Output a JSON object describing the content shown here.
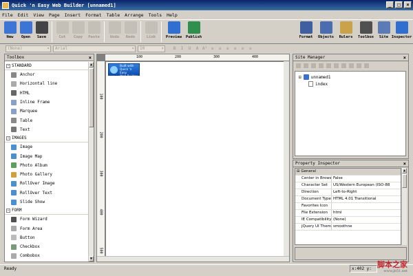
{
  "window": {
    "title": "Quick 'n Easy Web Builder [unnamed1]",
    "min": "_",
    "max": "□",
    "close": "×"
  },
  "menu": [
    "File",
    "Edit",
    "View",
    "Page",
    "Insert",
    "Format",
    "Table",
    "Arrange",
    "Tools",
    "Help"
  ],
  "toolbar": {
    "left": [
      {
        "label": "New",
        "icon": "new-icon",
        "color": "#3b76d6",
        "enabled": true
      },
      {
        "label": "Open",
        "icon": "open-icon",
        "color": "#3b76d6",
        "enabled": true
      },
      {
        "label": "Save",
        "icon": "save-icon",
        "color": "#444444",
        "enabled": true
      },
      {
        "label": "Cut",
        "icon": "cut-icon",
        "color": "#999999",
        "enabled": false
      },
      {
        "label": "Copy",
        "icon": "copy-icon",
        "color": "#999999",
        "enabled": false
      },
      {
        "label": "Paste",
        "icon": "paste-icon",
        "color": "#999999",
        "enabled": false
      },
      {
        "label": "Undo",
        "icon": "undo-icon",
        "color": "#999999",
        "enabled": false
      },
      {
        "label": "Redo",
        "icon": "redo-icon",
        "color": "#999999",
        "enabled": false
      },
      {
        "label": "Link",
        "icon": "link-icon",
        "color": "#999999",
        "enabled": false
      },
      {
        "label": "Preview",
        "icon": "preview-icon",
        "color": "#2f6fcf",
        "enabled": true
      },
      {
        "label": "Publish",
        "icon": "publish-icon",
        "color": "#2f8f4f",
        "enabled": true
      }
    ],
    "right": [
      {
        "label": "Format",
        "icon": "format-icon",
        "color": "#3f5fa0"
      },
      {
        "label": "Objects",
        "icon": "objects-icon",
        "color": "#4a6cb0"
      },
      {
        "label": "Rulers",
        "icon": "rulers-icon",
        "color": "#c9a24a"
      },
      {
        "label": "Toolbox",
        "icon": "toolbox-icon",
        "color": "#505050"
      },
      {
        "label": "Site",
        "icon": "site-icon",
        "color": "#5a7ab8"
      },
      {
        "label": "Inspector",
        "icon": "inspector-icon",
        "color": "#2f6fcf"
      }
    ]
  },
  "format_bar": {
    "style": "(None)",
    "font": "Arial",
    "size": "10",
    "buttons": [
      "B",
      "I",
      "U",
      "A",
      "A²",
      "≡",
      "≡",
      "≡",
      "≡",
      "≡",
      "≡"
    ]
  },
  "toolbox": {
    "title": "Toolbox",
    "groups": [
      {
        "name": "STANDARD",
        "items": [
          {
            "label": "Anchor",
            "icon": "anchor-icon",
            "color": "#888888"
          },
          {
            "label": "Horizontal line",
            "icon": "horizontal-line-icon",
            "color": "#aaaaaa"
          },
          {
            "label": "HTML",
            "icon": "html-icon",
            "color": "#666666"
          },
          {
            "label": "Inline Frame",
            "icon": "inline-frame-icon",
            "color": "#8aa0c8"
          },
          {
            "label": "Marquee",
            "icon": "marquee-icon",
            "color": "#8aa0c8"
          },
          {
            "label": "Table",
            "icon": "table-icon",
            "color": "#8a8a8a"
          },
          {
            "label": "Text",
            "icon": "text-icon",
            "color": "#777777"
          }
        ]
      },
      {
        "name": "IMAGES",
        "items": [
          {
            "label": "Image",
            "icon": "image-icon",
            "color": "#4a8fd0"
          },
          {
            "label": "Image Map",
            "icon": "image-map-icon",
            "color": "#4a8fd0"
          },
          {
            "label": "Photo Album",
            "icon": "photo-album-icon",
            "color": "#5a9f5a"
          },
          {
            "label": "Photo Gallery",
            "icon": "photo-gallery-icon",
            "color": "#d0a040"
          },
          {
            "label": "RollOver Image",
            "icon": "rollover-image-icon",
            "color": "#4a8fd0"
          },
          {
            "label": "RollOver Text",
            "icon": "rollover-text-icon",
            "color": "#4a8fd0"
          },
          {
            "label": "Slide Show",
            "icon": "slide-show-icon",
            "color": "#4a8fd0"
          }
        ]
      },
      {
        "name": "FORM",
        "items": [
          {
            "label": "Form Wizard",
            "icon": "form-wizard-icon",
            "color": "#505050"
          },
          {
            "label": "Form Area",
            "icon": "form-area-icon",
            "color": "#aaaaaa"
          },
          {
            "label": "Button",
            "icon": "button-icon",
            "color": "#bbbbbb"
          },
          {
            "label": "Checkbox",
            "icon": "checkbox-icon",
            "color": "#7a9a7a"
          },
          {
            "label": "Combobox",
            "icon": "combobox-icon",
            "color": "#aaaaaa"
          }
        ]
      }
    ]
  },
  "editor": {
    "ruler_h": [
      "100",
      "200",
      "300",
      "400"
    ],
    "ruler_v": [
      "100",
      "200",
      "300",
      "400",
      "500"
    ],
    "badge_lines": [
      "Built with",
      "Quick 'n Easy",
      "Web Builder"
    ]
  },
  "site_manager": {
    "title": "Site Manager",
    "root": "unnamed1",
    "child": "index"
  },
  "property_inspector": {
    "title": "Property Inspector",
    "group": "General",
    "rows": [
      {
        "k": "Center in Browser",
        "v": "False"
      },
      {
        "k": "Character Set",
        "v": "US/Western European (ISO-88"
      },
      {
        "k": "Direction",
        "v": "Left-to-Right"
      },
      {
        "k": "Document Type",
        "v": "HTML 4.01 Transitional"
      },
      {
        "k": "Favorites Icon",
        "v": ""
      },
      {
        "k": "File Extension",
        "v": "html"
      },
      {
        "k": "IE Compatibility",
        "v": "(None)"
      },
      {
        "k": "jQuery UI Theme",
        "v": "smoothne"
      }
    ]
  },
  "status": {
    "left": "Ready",
    "right": "x:402 y:"
  },
  "watermark": {
    "main": "脚本之家",
    "sub": "www.jb51.net"
  }
}
